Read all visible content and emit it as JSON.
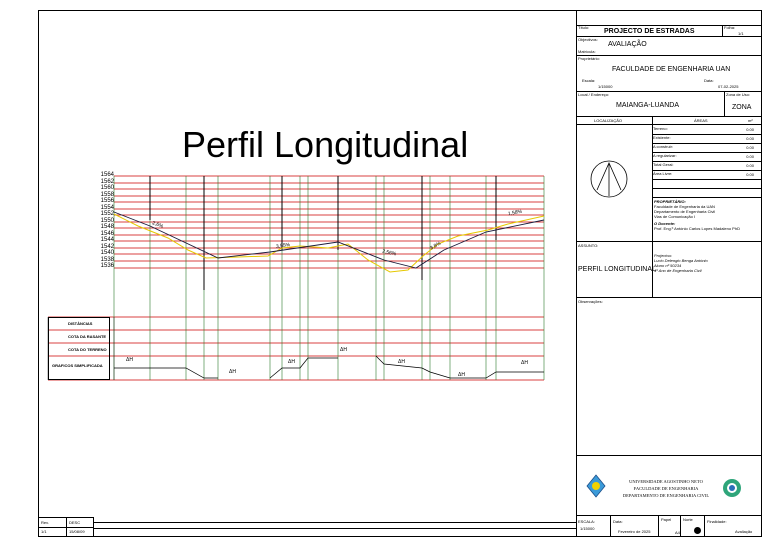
{
  "drawing": {
    "title": "Perfil Longitudinal",
    "elevations": [
      "1564",
      "1562",
      "1560",
      "1558",
      "1556",
      "1554",
      "1552",
      "1550",
      "1548",
      "1546",
      "1544",
      "1542",
      "1540",
      "1538",
      "1536"
    ],
    "slopes": [
      "2,6%",
      "3,55%",
      "2,56%",
      "3,8%",
      "1,58%"
    ],
    "band_labels": [
      "DISTÂNCIAS",
      "COTA DA RASANTE",
      "COTA DO TERRENO",
      "GRAFICOS SIMPLIFICADA"
    ],
    "delta_h_label": "ΔH"
  },
  "title_block": {
    "titulo_label": "Título:",
    "titulo": "PROJECTO DE ESTRADAS",
    "folha_label": "Folha:",
    "folha": "1/1",
    "objectivo_label": "Objectivos:",
    "objectivo": "AVALIAÇÃO",
    "matricula_label": "Matrícula:",
    "proprietario_label": "Proprietário:",
    "proprietario": "FACULDADE DE ENGENHARIA UAN",
    "escala_label": "Escala:",
    "escala": "1/15000",
    "data_label": "Data:",
    "data": "07-02-2025",
    "local_label": "Local / Endereço:",
    "local": "MAIANGA-LUANDA",
    "zona_label": "Zona de Uso:",
    "zona": "ZONA",
    "localizacao": "LOCALIZAÇÃO",
    "areas": "ÁREAS",
    "unit": "m²",
    "area_rows": [
      {
        "label": "Terreno:",
        "value": "0.00"
      },
      {
        "label": "Existente:",
        "value": "0.00"
      },
      {
        "label": "A construir:",
        "value": "0.00"
      },
      {
        "label": "A regularizar:",
        "value": "0.00"
      },
      {
        "label": "Total Geral:",
        "value": "0.00"
      },
      {
        "label": "Área Livre:",
        "value": "0.00"
      }
    ],
    "owner_heading": "PROPRIETÁRIO:",
    "owner_lines": [
      "Faculdade de Engenharia da UAN",
      "Departamento de Engenharia Civil",
      "Vias de Comunicação I"
    ],
    "docente_heading": "O Docente:",
    "docente": "Prof. Eng.º António Carlos Lopes Madaleno PhD",
    "assunto_label": "ASSUNTO:",
    "assunto": "PERFIL LONGITUDINAL",
    "projectista_heading": "Projectou:",
    "projectista_lines": [
      "Lucio Delengio Benga António",
      "Aluno nº 50234",
      "4º Ano de Engenharia Civil"
    ],
    "observacoes_label": "Observações:",
    "university_lines": [
      "UNIVERSIDADE AGOSTINHO NETO",
      "FACULDADE DE ENGENHARIA",
      "DEPARTAMENTO DE ENGENHARIA CIVIL"
    ],
    "bottom": {
      "escala_label": "ESCALA:",
      "escala": "1/15000",
      "data_label": "Data:",
      "data": "Fevereiro de 2025",
      "papel_label": "Papel",
      "papel": "A4",
      "norte_label": "Norte",
      "finalidade_label": "Finalidade:",
      "finalidade": "Avaliação"
    }
  },
  "revision_box": {
    "c1": "Rev.",
    "c2": "DESC",
    "c3": "1/1",
    "c4": "15/08/09"
  }
}
